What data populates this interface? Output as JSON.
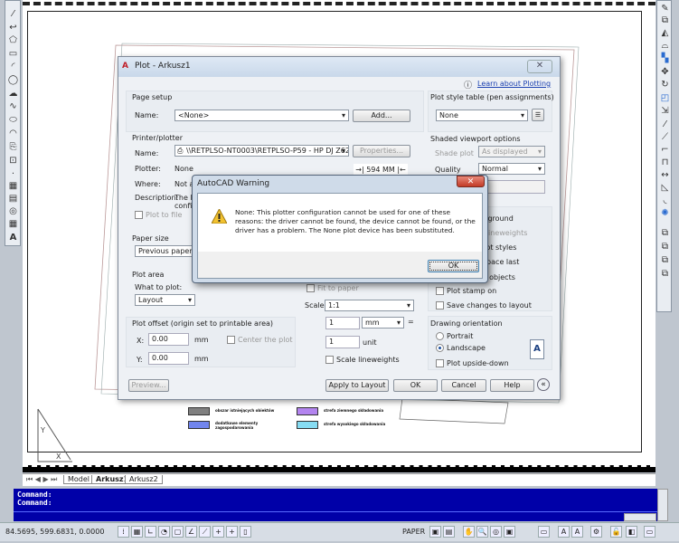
{
  "plot_dialog": {
    "title": "Plot - Arkusz1",
    "learn_link": "Learn about Plotting",
    "page_setup": {
      "label": "Page setup",
      "name_label": "Name:",
      "name_value": "<None>",
      "add_button": "Add..."
    },
    "printer": {
      "label": "Printer/plotter",
      "name_label": "Name:",
      "name_value": "\\\\RETPLSO-NT0003\\RETPLSO-P59 - HP DJ Z6200",
      "properties_button": "Properties...",
      "plotter_label": "Plotter:",
      "plotter_value": "None",
      "where_label": "Where:",
      "where_value": "Not ap",
      "description_label": "Description:",
      "description_value_1": "The la",
      "description_value_2": "config",
      "plot_to_file": "Plot to file",
      "preview_dim": "594 MM"
    },
    "paper_size": {
      "label": "Paper size",
      "value": "Previous paper size"
    },
    "plot_area": {
      "label": "Plot area",
      "what_label": "What to plot:",
      "what_value": "Layout"
    },
    "plot_offset": {
      "label": "Plot offset (origin set to printable area)",
      "x_label": "X:",
      "x_value": "0.00",
      "y_label": "Y:",
      "y_value": "0.00",
      "unit": "mm",
      "center": "Center the plot"
    },
    "plot_scale": {
      "fit": "Fit to paper",
      "scale_label": "Scale:",
      "scale_value": "1:1",
      "mm_value": "1",
      "mm_unit": "mm",
      "equals": "=",
      "unit_value": "1",
      "unit_label": "unit",
      "scale_lineweights": "Scale lineweights"
    },
    "plot_style": {
      "label": "Plot style table (pen assignments)",
      "value": "None"
    },
    "shaded": {
      "label": "Shaded viewport options",
      "shade_label": "Shade plot",
      "shade_value": "As displayed",
      "quality_label": "Quality",
      "quality_value": "Normal"
    },
    "options": [
      "Plot in background",
      "Plot object lineweights",
      "Plot with plot styles",
      "Plot paperspace last",
      "Hide paperspace objects",
      "Plot stamp on",
      "Save changes to layout"
    ],
    "orientation": {
      "label": "Drawing orientation",
      "portrait": "Portrait",
      "landscape": "Landscape",
      "upside_down": "Plot upside-down"
    },
    "buttons": {
      "preview": "Preview...",
      "apply": "Apply to Layout",
      "ok": "OK",
      "cancel": "Cancel",
      "help": "Help"
    }
  },
  "warning": {
    "title": "AutoCAD Warning",
    "line1": "None: This plotter configuration cannot be used for one of these",
    "line2": "reasons: the driver cannot be found, the device cannot be found, or the",
    "line3": "driver has a problem. The None plot device has been substituted.",
    "ok": "OK"
  },
  "legend": [
    {
      "label": "obszar istniejących obiektów",
      "color": "#808080"
    },
    {
      "label": "strefa ziemnego składowania",
      "color": "#b384ef"
    },
    {
      "label": "dodatkowe elementy zagospodarowania",
      "color": "#7185ee"
    },
    {
      "label": "strefa wysokiego składowania",
      "color": "#86dcf2"
    }
  ],
  "layout_tabs": [
    "Model",
    "Arkusz1",
    "Arkusz2"
  ],
  "command": {
    "line1": "Command:",
    "line2": "Command:"
  },
  "status": {
    "coords": "84.5695, 599.6831, 0.0000",
    "space": "PAPER"
  }
}
